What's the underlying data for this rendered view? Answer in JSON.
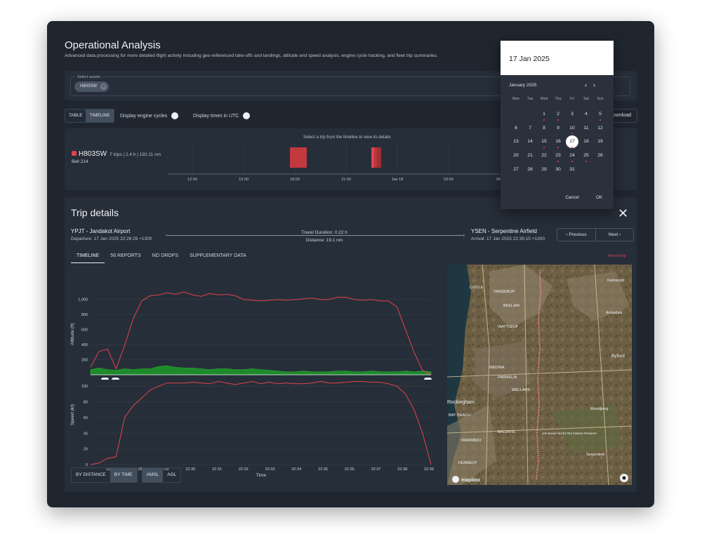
{
  "header": {
    "title": "Operational Analysis",
    "subtitle": "Advanced data processing for more detailed flight activity including geo-referenced take-offs and landings, altitude and speed analysis, engine cycle tracking, and fleet trip summaries."
  },
  "assets": {
    "label": "Select assets",
    "chip": "H803SW"
  },
  "view_toggle": {
    "table": "TABLE",
    "timeline": "TIMELINE",
    "active": "TIMELINE"
  },
  "switches": {
    "engine_cycles": "Display engine cycles",
    "utc": "Display times in UTC"
  },
  "download": "Download",
  "timeline": {
    "hint": "Select a trip from the timeline to view its details",
    "aircraft": "H803SW",
    "stats": "7 trips | 2.4 h | 192.11 nm",
    "type": "Bell 214",
    "ticks": [
      "12:00",
      "15:00",
      "18:00",
      "21:00",
      "Jan 18",
      "03:00",
      "06"
    ]
  },
  "trip": {
    "title": "Trip details",
    "from": "YPJT - Jandakot Airport",
    "departure": "Departure: 17 Jan 2025 22:26:26 +1300",
    "to": "YSEN - Serpentine Airfield",
    "arrival": "Arrival: 17 Jan 2025 22:39:15 +1300",
    "travel_duration": "Travel Duration:  0.22 h",
    "distance": "Distance:  19.1 nm",
    "prev": "Previous",
    "next": "Next",
    "tabs": [
      "TIMELINE",
      "56 REPORTS",
      "NO DROPS",
      "SUPPLEMENTARY DATA"
    ],
    "amend": "Amend trip"
  },
  "chart_data": [
    {
      "type": "area",
      "ylabel": "Altitude (ft)",
      "ylim": [
        0,
        1100
      ],
      "y_ticks": [
        "200",
        "400",
        "600",
        "800",
        "1,000"
      ],
      "series": [
        {
          "values": [
            100,
            310,
            340,
            80,
            390,
            740,
            980,
            1050,
            1060,
            1090,
            1070,
            1100,
            1060,
            1040,
            1080,
            1060,
            1070,
            1050,
            1000,
            990,
            980,
            990,
            1000,
            990,
            1000,
            1010,
            1020,
            1000,
            1000,
            1030,
            1030,
            1000,
            990,
            1000,
            980,
            980,
            900,
            600,
            300,
            60,
            0
          ]
        },
        {
          "values": [
            70,
            90,
            70,
            60,
            80,
            70,
            80,
            80,
            110,
            120,
            100,
            90,
            90,
            80,
            70,
            80,
            80,
            70,
            70,
            80,
            70,
            60,
            50,
            40,
            40,
            50,
            40,
            40,
            40,
            50,
            50,
            40,
            40,
            50,
            40,
            40,
            40,
            50,
            40,
            50,
            40
          ]
        }
      ]
    },
    {
      "type": "line",
      "xlabel": "Time",
      "ylabel": "Speed (kt)",
      "ylim": [
        0,
        110
      ],
      "x_ticks": [
        "22:27",
        "22:28",
        "22:29",
        "22:30",
        "22:31",
        "22:32",
        "22:33",
        "22:34",
        "22:35",
        "22:36",
        "22:37",
        "22:38",
        "22:39"
      ],
      "y_ticks": [
        "0",
        "20",
        "40",
        "60",
        "80",
        "100"
      ],
      "series": [
        {
          "values": [
            0,
            2,
            8,
            10,
            60,
            75,
            85,
            95,
            100,
            104,
            104,
            104,
            105,
            104,
            103,
            106,
            104,
            102,
            104,
            106,
            103,
            105,
            103,
            104,
            103,
            103,
            104,
            106,
            104,
            104,
            105,
            106,
            106,
            105,
            105,
            103,
            100,
            90,
            70,
            40,
            0
          ]
        }
      ]
    }
  ],
  "bottom": {
    "by_distance": "BY DISTANCE",
    "by_time": "BY TIME",
    "amsl": "AMSL",
    "agl": "AGL"
  },
  "map": {
    "labels": [
      "COOLE",
      "YANGEBUP",
      "BEELIAR",
      "WATTLEUP",
      "MEDINA",
      "PARMELIA",
      "WELLARD",
      "Rockingham",
      "BAY BEACH",
      "BALDIVIS",
      "WARNBRO",
      "KENNEDY",
      "Byford",
      "Kelmscott",
      "Armadale",
      "Mundijong",
      "Serpentine",
      "Unnamed WA51784 Nature Reserve"
    ],
    "brand": "mapbox"
  },
  "calendar": {
    "header": "17 Jan 2025",
    "month": "January 2025",
    "weekdays": [
      "Mon",
      "Tue",
      "Wed",
      "Thu",
      "Fri",
      "Sat",
      "Sun"
    ],
    "cancel": "Cancel",
    "ok": "OK"
  }
}
